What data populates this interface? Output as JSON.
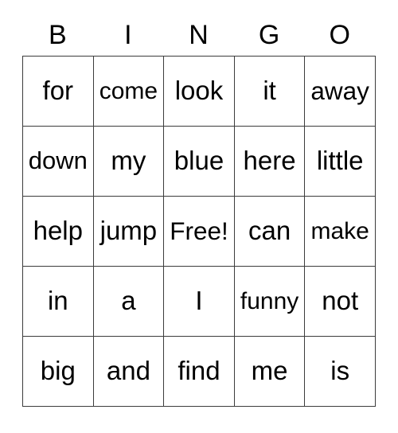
{
  "card": {
    "title": "BINGO",
    "free_space_label": "Free!",
    "colors": {
      "background": "#ffffff",
      "text": "#000000",
      "grid_line": "#3c3c3c"
    },
    "header": {
      "letters": [
        "B",
        "I",
        "N",
        "G",
        "O"
      ]
    },
    "grid": {
      "columns": 5,
      "rows": 5,
      "cells": [
        [
          "for",
          "come",
          "look",
          "it",
          "away"
        ],
        [
          "down",
          "my",
          "blue",
          "here",
          "little"
        ],
        [
          "help",
          "jump",
          "Free!",
          "can",
          "make"
        ],
        [
          "in",
          "a",
          "I",
          "funny",
          "not"
        ],
        [
          "big",
          "and",
          "find",
          "me",
          "is"
        ]
      ]
    }
  }
}
